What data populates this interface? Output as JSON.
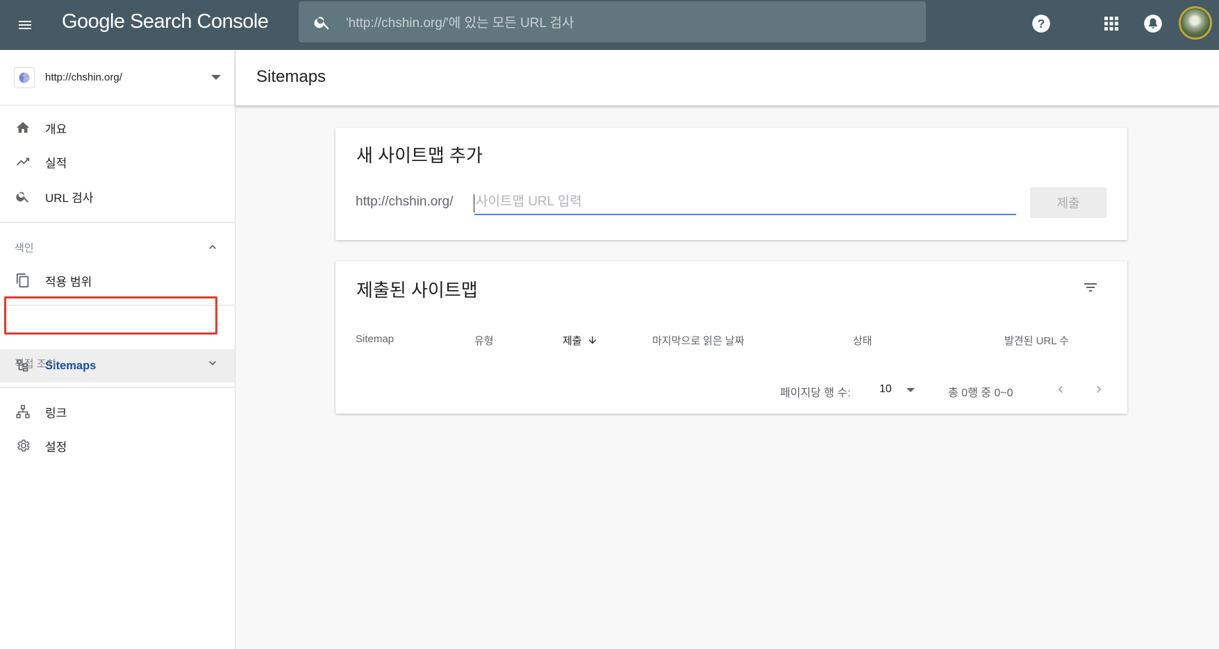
{
  "header": {
    "brand": "Google Search Console",
    "search_placeholder": "'http://chshin.org/'에 있는 모든 URL 검사",
    "icons": [
      "menu-icon",
      "search-icon",
      "help-icon",
      "apps-icon",
      "notifications-icon"
    ]
  },
  "sidebar": {
    "property": "http://chshin.org/",
    "items_top": [
      {
        "label": "개요",
        "icon": "home-icon"
      },
      {
        "label": "실적",
        "icon": "trending-up-icon"
      },
      {
        "label": "URL 검사",
        "icon": "search-icon"
      }
    ],
    "section_index": {
      "label": "색인",
      "items": [
        {
          "label": "적용 범위",
          "icon": "copy-icon"
        },
        {
          "label": "Sitemaps",
          "icon": "sitemap-icon"
        }
      ]
    },
    "section_manual": {
      "label": "직접 조치"
    },
    "items_bottom": [
      {
        "label": "링크",
        "icon": "links-icon"
      },
      {
        "label": "설정",
        "icon": "settings-icon"
      }
    ]
  },
  "page": {
    "title": "Sitemaps"
  },
  "add_card": {
    "title": "새 사이트맵 추가",
    "prefix": "http://chshin.org/",
    "input_placeholder": "사이트맵 URL 입력",
    "submit_label": "제출"
  },
  "submitted_card": {
    "title": "제출된 사이트맵",
    "columns": [
      "Sitemap",
      "유형",
      "제출",
      "마지막으로 읽은 날짜",
      "상태",
      "발견된 URL 수"
    ],
    "rows": [],
    "pagination": {
      "rows_per_page_label": "페이지당 행 수:",
      "rows_per_page": "10",
      "range_text": "총 0행 중 0~0"
    }
  },
  "colors": {
    "topbar": "#455a64",
    "accent": "#4285f4",
    "highlight": "#e53929"
  }
}
